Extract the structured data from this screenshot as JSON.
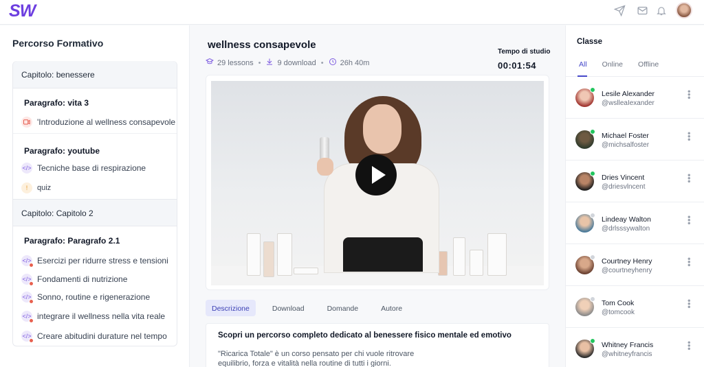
{
  "brand": {
    "logo_text": "SW",
    "accent": "#6d3fe0"
  },
  "topbar": {
    "icons": [
      "send-icon",
      "mail-icon",
      "bell-icon"
    ],
    "avatar": "user-avatar"
  },
  "sidebar": {
    "title": "Percorso Formativo",
    "chapters": [
      {
        "label": "Capitolo: benessere"
      },
      {
        "label": "Capitolo: Capitolo 2"
      }
    ],
    "paragraphs": [
      {
        "label": "Paragrafo: vita 3"
      },
      {
        "label": "Paragrafo: youtube"
      },
      {
        "label": "Paragrafo: Paragrafo 2.1"
      }
    ],
    "lessons": [
      {
        "label": "'Introduzione al wellness consapevole",
        "icon": "video-icon"
      },
      {
        "label": "Tecniche base di respirazione",
        "icon": "code-icon"
      },
      {
        "label": "quiz",
        "icon": "quiz-icon"
      },
      {
        "label": "Esercizi per ridurre stress e tensioni",
        "icon": "code-icon"
      },
      {
        "label": "Fondamenti di nutrizione",
        "icon": "code-icon"
      },
      {
        "label": "Sonno, routine e rigenerazione",
        "icon": "code-icon"
      },
      {
        "label": "integrare il wellness nella vita reale",
        "icon": "code-icon"
      },
      {
        "label": "Creare abitudini durature nel tempo",
        "icon": "code-icon"
      }
    ]
  },
  "main": {
    "title": "wellness consapevole",
    "meta": {
      "lessons": "29 lessons",
      "downloads": "9 download",
      "duration": "26h 40m"
    },
    "study": {
      "label": "Tempo di studio",
      "time": "00:01:54"
    },
    "tabs": [
      "Descrizione",
      "Download",
      "Domande",
      "Autore"
    ],
    "active_tab": "Descrizione",
    "description": {
      "heading": "Scopri un percorso completo dedicato al benessere fisico mentale ed emotivo",
      "body": "\"Ricarica Totale\" è un corso pensato per chi vuole ritrovare equilibrio, forza e vitalità nella routine di tutti i giorni."
    }
  },
  "class_panel": {
    "title": "Classe",
    "tabs": [
      "All",
      "Online",
      "Offline"
    ],
    "active_tab": "All",
    "members": [
      {
        "name": "Lesile Alexander",
        "handle": "@wslleaIexander",
        "status": "online",
        "status_color": "#22c55e"
      },
      {
        "name": "Michael Foster",
        "handle": "@michsalfoster",
        "status": "online",
        "status_color": "#22c55e"
      },
      {
        "name": "Dries Vincent",
        "handle": "@driesvlncent",
        "status": "online",
        "status_color": "#22c55e"
      },
      {
        "name": "Lindeay Walton",
        "handle": "@drlsssywalton",
        "status": "offline",
        "status_color": "#d1d5db"
      },
      {
        "name": "Courtney Henry",
        "handle": "@courtneyhenry",
        "status": "offline",
        "status_color": "#d1d5db"
      },
      {
        "name": "Tom Cook",
        "handle": "@tomcook",
        "status": "offline",
        "status_color": "#d1d5db"
      },
      {
        "name": "Whitney Francis",
        "handle": "@whitneyfrancis",
        "status": "online",
        "status_color": "#22c55e"
      }
    ]
  }
}
